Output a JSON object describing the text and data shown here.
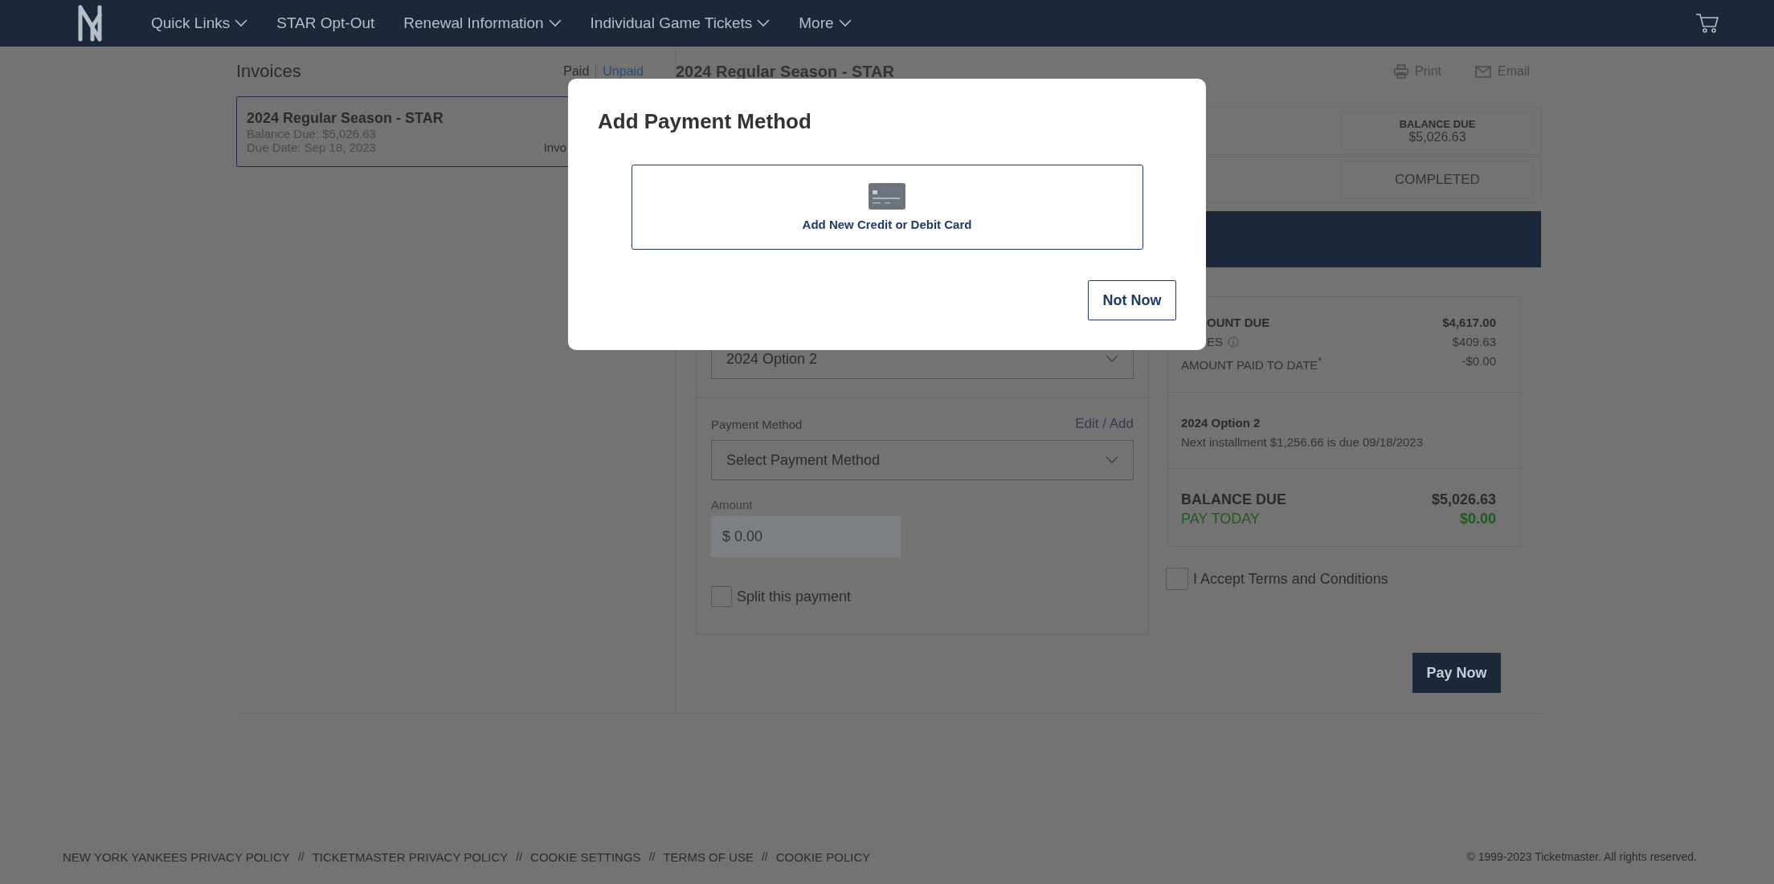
{
  "nav": {
    "items": [
      {
        "label": "Quick Links",
        "dropdown": true
      },
      {
        "label": "STAR Opt-Out",
        "dropdown": false
      },
      {
        "label": "Renewal Information",
        "dropdown": true
      },
      {
        "label": "Individual Game Tickets",
        "dropdown": true
      },
      {
        "label": "More",
        "dropdown": true
      }
    ]
  },
  "invoices": {
    "title": "Invoices",
    "filters": [
      {
        "label": "Paid",
        "selected": false
      },
      {
        "label": "Unpaid",
        "selected": true
      }
    ],
    "items": [
      {
        "title": "2024 Regular Season - STAR",
        "balance": "Balance Due: $5,026.63",
        "due": "Due Date: Sep 18, 2023",
        "column_3": "Invo",
        "selected": true
      }
    ]
  },
  "invoice_detail": {
    "title": "2024 Regular Season - STAR",
    "actions": [
      {
        "label": "Print",
        "kind": "print"
      },
      {
        "label": "Email",
        "kind": "email"
      }
    ],
    "balance_due": {
      "label": "BALANCE DUE",
      "value": "$5,026.63"
    },
    "status": "COMPLETED",
    "form": {
      "plan_select": {
        "value": "2024 Option 2"
      },
      "payment_method": {
        "label": "Payment Method",
        "link": "Edit / Add",
        "select": {
          "value": "Select Payment Method"
        }
      },
      "amount": {
        "label": "Amount",
        "placeholder": "$ 0.00",
        "disabled": true
      },
      "split": {
        "label": "Split this payment",
        "checked": false
      }
    },
    "summary": {
      "lines": [
        {
          "label": "OUNT DUE",
          "value": "$4,617.00",
          "bold": true,
          "info": false
        },
        {
          "label": "ES",
          "value": "$409.63",
          "bold": false,
          "info": true
        },
        {
          "label": "AMOUNT PAID TO DATE$^{*}$",
          "value": "-$0.00",
          "bold": false,
          "info": false
        }
      ],
      "plan": {
        "title": "2024 Option 2",
        "note": "Next installment $1,256.66 is due 09/18/2023"
      },
      "balance": {
        "label": "BALANCE DUE",
        "value": "$5,026.63"
      },
      "pay_today": {
        "label": "PAY TODAY",
        "value": "$0.00"
      }
    },
    "terms": {
      "label": "I Accept Terms and Conditions",
      "checked": false
    },
    "pay_button": "Pay Now"
  },
  "modal": {
    "title": "Add Payment Method",
    "options": [
      {
        "label": "Add New Credit or Debit Card",
        "kind": "card"
      }
    ],
    "buttons": [
      {
        "label": "Not Now"
      }
    ]
  },
  "footer": {
    "links": [
      "NEW YORK YANKEES PRIVACY POLICY",
      "TICKETMASTER PRIVACY POLICY",
      "COOKIE SETTINGS",
      "TERMS OF USE",
      "COOKIE POLICY"
    ],
    "separators": [
      "//",
      "//",
      "//",
      "//"
    ],
    "copyright": "© 1999-2023 Ticketmaster. All rights reserved."
  }
}
